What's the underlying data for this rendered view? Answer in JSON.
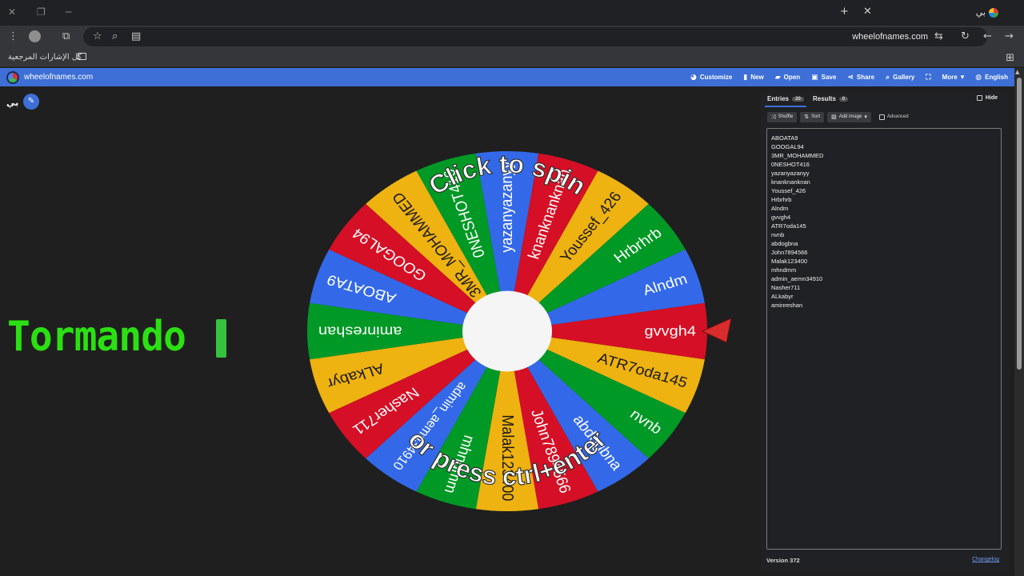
{
  "browser": {
    "tab_title": "بي",
    "url": "wheelofnames.com",
    "bookmark_label": "كل الإشارات المرجعية"
  },
  "site": {
    "name": "wheelofnames.com",
    "nav": {
      "customize": "Customize",
      "new": "New",
      "open": "Open",
      "save": "Save",
      "share": "Share",
      "gallery": "Gallery",
      "more": "More",
      "language": "English"
    },
    "user_name": "بي"
  },
  "overlay_text": "Tormando",
  "wheel": {
    "prompt_top": "Click to spin",
    "prompt_bottom": "or press ctrl+enter",
    "pointer_target": "gvvgh4",
    "segments": [
      "ABOATA9",
      "GOOGAL94",
      "3MR_MOHAMMED",
      "0NESHOT416",
      "yazanyazanyy",
      "knanknanknan",
      "Youssef_426",
      "Hrbrhrb",
      "Alndm",
      "gvvgh4",
      "ATR7oda145",
      "nvnb",
      "abdogbna",
      "John7894566",
      "Malak123400",
      "mhndmm",
      "admin_aemn34910",
      "Nasher711",
      "ALkabyr",
      "aminreshan"
    ]
  },
  "panel": {
    "tab_entries": "Entries",
    "entries_count": "20",
    "tab_results": "Results",
    "results_count": "0",
    "hide_label": "Hide",
    "shuffle": "Shuffle",
    "sort": "Sort",
    "add_image": "Add image",
    "advanced": "Advanced",
    "entries": [
      "ABOATA9",
      "GOOGAL94",
      "3MR_MOHAMMED",
      "0NESHOT416",
      "yazanyazanyy",
      "knanknanknan",
      "Youssef_426",
      "Hrbrhrb",
      "Alndm",
      "gvvgh4",
      "ATR7oda145",
      "nvnb",
      "abdogbna",
      "John7894566",
      "Malak123400",
      "mhndmm",
      "admin_aemn34910",
      "Nasher711",
      "ALkabyr",
      "aminreshan"
    ],
    "version": "Version 372",
    "changelog": "Changelog"
  },
  "colors": {
    "wheel": [
      "#3369e8",
      "#d50f25",
      "#eeb211",
      "#009925"
    ],
    "nav_blue": "#3d6fd6",
    "overlay_green": "#2be012",
    "pointer": "#d92c2c"
  }
}
